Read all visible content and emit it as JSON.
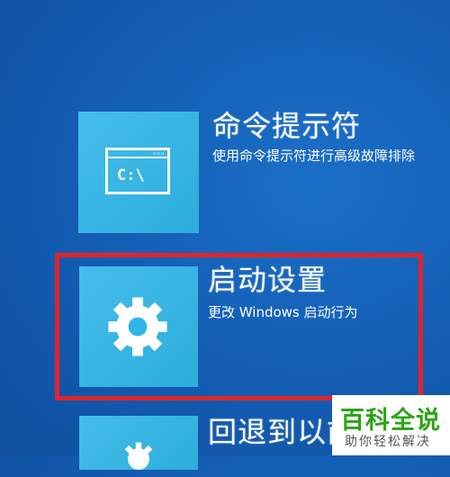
{
  "options": {
    "command_prompt": {
      "title": "命令提示符",
      "description": "使用命令提示符进行高级故障排除",
      "icon": "command-prompt-icon",
      "icon_text": "C:\\"
    },
    "startup_settings": {
      "title": "启动设置",
      "description": "更改 Windows 启动行为",
      "icon": "gear-icon"
    },
    "go_back": {
      "title": "回退到以前",
      "icon": "gear-icon"
    }
  },
  "watermark": {
    "title": "百科全说",
    "subtitle": "助你轻松解决"
  },
  "colors": {
    "background": "#145fb6",
    "tile": "#2fb6e8",
    "highlight_frame": "#e0242a",
    "watermark_title": "#2aa515"
  }
}
